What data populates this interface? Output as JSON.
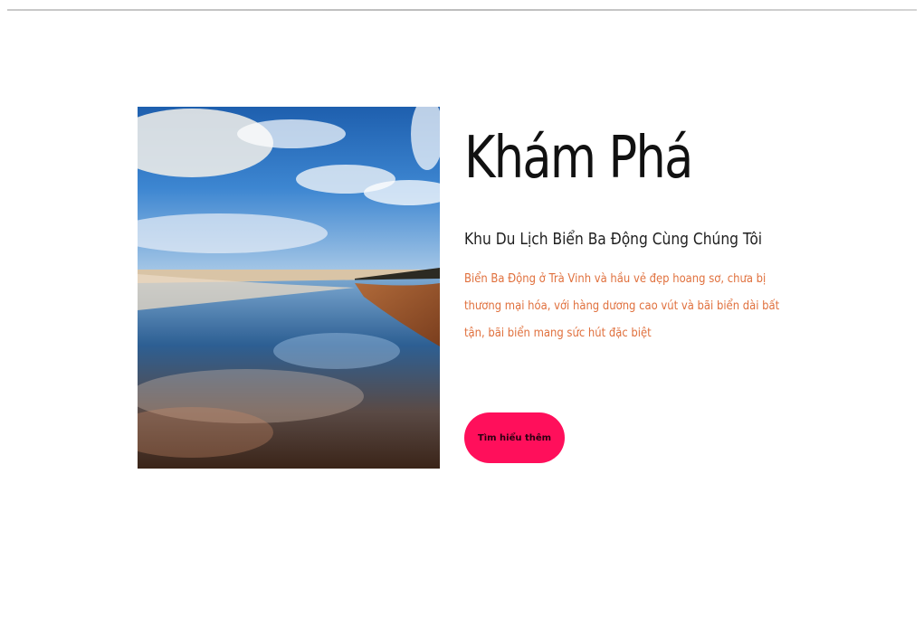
{
  "hero": {
    "title": "Khám Phá",
    "subtitle": "Khu Du Lịch Biển Ba Động Cùng Chúng Tôi",
    "description": "Biển Ba Động ở Trà Vinh và hầu vẻ đẹp hoang sơ, chưa bị thương mại hóa, với hàng dương cao vút và bãi biển dài bất tận, bãi biển mang sức hút đặc biệt",
    "cta_label": "Tìm hiểu thêm"
  },
  "colors": {
    "accent": "#ff0f5b",
    "description_text": "#e0703d",
    "title_text": "#111111"
  },
  "icons": {
    "hero_image": "beach-photo"
  }
}
